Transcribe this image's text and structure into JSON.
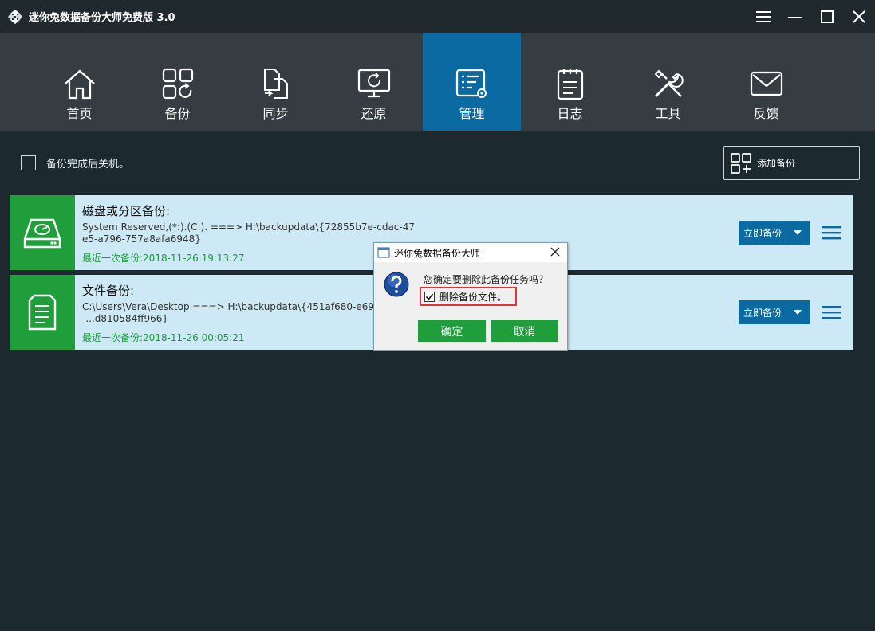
{
  "window": {
    "title": "迷你兔数据备份大师免费版 3.0",
    "controls": [
      "menu-icon",
      "minimize-icon",
      "maximize-icon",
      "close-icon"
    ]
  },
  "nav": {
    "items": [
      {
        "label": "首页",
        "icon": "home-icon",
        "active": false
      },
      {
        "label": "备份",
        "icon": "backup-icon",
        "active": false
      },
      {
        "label": "同步",
        "icon": "sync-icon",
        "active": false
      },
      {
        "label": "还原",
        "icon": "restore-icon",
        "active": false
      },
      {
        "label": "管理",
        "icon": "manage-icon",
        "active": true
      },
      {
        "label": "日志",
        "icon": "log-icon",
        "active": false
      },
      {
        "label": "工具",
        "icon": "tools-icon",
        "active": false
      },
      {
        "label": "反馈",
        "icon": "feedback-icon",
        "active": false
      }
    ]
  },
  "main": {
    "shutdown_label": "备份完成后关机。",
    "shutdown_checked": false,
    "add_backup_label": "添加备份",
    "tasks": [
      {
        "title": "磁盘或分区备份:",
        "path": "System Reserved,(*:).(C:). ===> H:\\backupdata\\{72855b7e-cdac-47e5-a796-757a8afa6948}",
        "last_label": "最近一次备份:",
        "last_time": "2018-11-26 19:13:27",
        "run_label": "立即备份",
        "icon": "disk-icon"
      },
      {
        "title": "文件备份:",
        "path": "C:\\Users\\Vera\\Desktop ===> H:\\backupdata\\{451af680-e69a-4d95-...d810584ff966}",
        "last_label": "最近一次备份:",
        "last_time": "2018-11-26 00:05:21",
        "run_label": "立即备份",
        "icon": "file-icon"
      }
    ]
  },
  "dialog": {
    "title": "迷你兔数据备份大师",
    "message": "您确定要删除此备份任务吗？",
    "option_label": "删除备份文件。",
    "option_checked": true,
    "ok_label": "确定",
    "cancel_label": "取消"
  },
  "colors": {
    "accent_blue": "#0b6aa2",
    "accent_green": "#1f9e3b",
    "card_bg": "#cde9f5",
    "highlight_red": "#e53238"
  }
}
